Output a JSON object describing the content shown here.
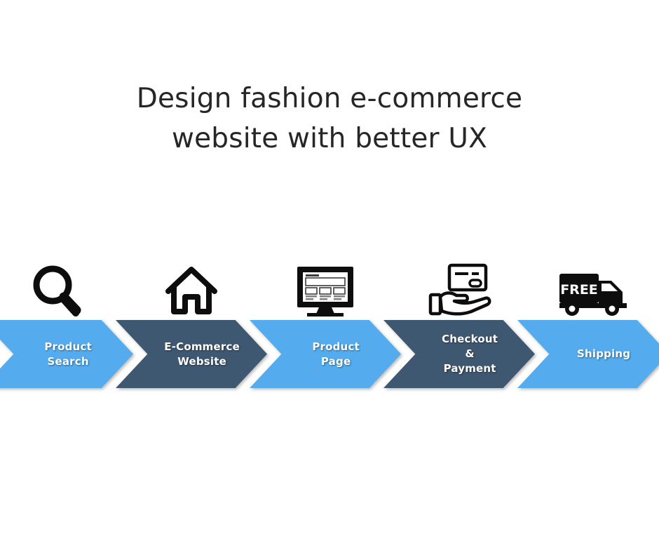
{
  "title": {
    "line1": "Design fashion e-commerce",
    "line2": "website with better UX"
  },
  "colors": {
    "light_blue": "#54ACEE",
    "dark_slate": "#3F5872",
    "title_text": "#262626",
    "label_text": "#FFFFFF",
    "background": "#FFFFFF",
    "icon": "#0D0D0D"
  },
  "flow": {
    "steps": [
      {
        "label": "Product\nSearch",
        "icon": "magnifying-glass-icon",
        "color_key": "light_blue"
      },
      {
        "label": "E-Commerce\nWebsite",
        "icon": "house-icon",
        "color_key": "dark_slate"
      },
      {
        "label": "Product\nPage",
        "icon": "desktop-monitor-icon",
        "color_key": "light_blue"
      },
      {
        "label": "Checkout\n&\nPayment",
        "icon": "hand-holding-credit-card-icon",
        "color_key": "dark_slate"
      },
      {
        "label": "Shipping",
        "icon": "delivery-truck-icon",
        "color_key": "light_blue",
        "icon_text": "FREE"
      }
    ]
  }
}
